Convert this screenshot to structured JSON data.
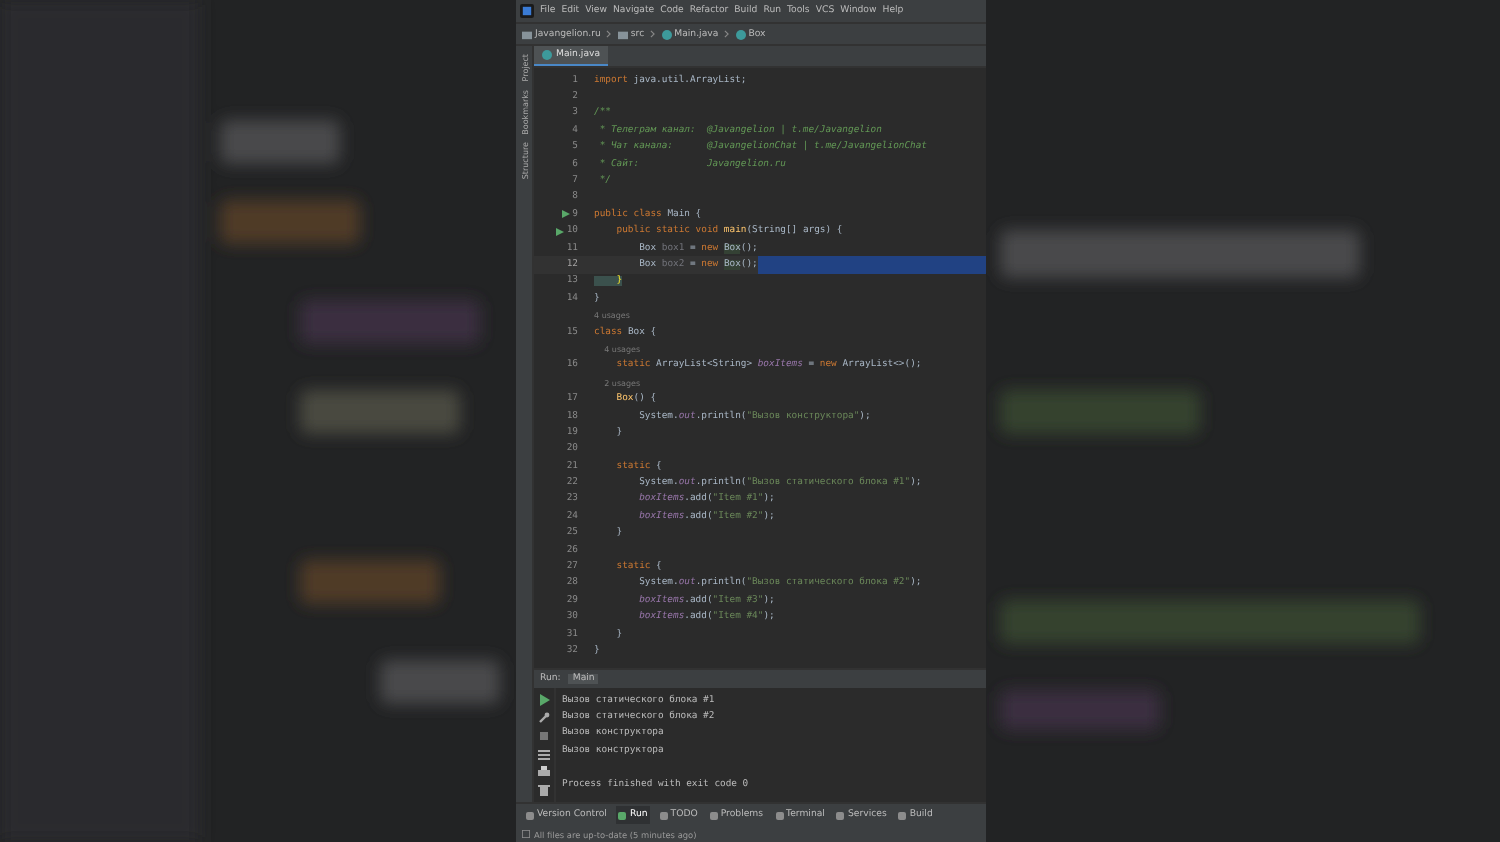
{
  "background": {
    "kind": "picture"
  },
  "menu": [
    "File",
    "Edit",
    "View",
    "Navigate",
    "Code",
    "Refactor",
    "Build",
    "Run",
    "Tools",
    "VCS",
    "Window",
    "Help"
  ],
  "breadcrumbs": [
    {
      "label": "Javangelion.ru",
      "kind": "folder"
    },
    {
      "label": "src",
      "kind": "folder"
    },
    {
      "label": "Main.java",
      "kind": "class"
    },
    {
      "label": "Box",
      "kind": "class"
    }
  ],
  "editor_tabs": [
    {
      "label": "Main.java",
      "selected": true
    }
  ],
  "side_tools": [
    "Project",
    "Bookmarks",
    "Structure"
  ],
  "code": [
    {
      "number": "1",
      "tokens": [
        {
          "kind": "kw",
          "text": "import"
        },
        {
          "kind": "plain",
          "text": " java.util.ArrayList;"
        }
      ]
    },
    {
      "number": "2"
    },
    {
      "number": "3",
      "tokens": [
        {
          "kind": "doc",
          "text": "/**"
        }
      ]
    },
    {
      "number": "4",
      "tokens": [
        {
          "kind": "doc",
          "text": " * Телеграм канал:  @Javangelion | t.me/Javangelion"
        }
      ]
    },
    {
      "number": "5",
      "tokens": [
        {
          "kind": "doc",
          "text": " * Чат канала:      @JavangelionChat | t.me/JavangelionChat"
        }
      ]
    },
    {
      "number": "6",
      "tokens": [
        {
          "kind": "doc",
          "text": " * Сайт:            Javangelion.ru"
        }
      ]
    },
    {
      "number": "7",
      "tokens": [
        {
          "kind": "doc",
          "text": " */"
        }
      ]
    },
    {
      "number": "8"
    },
    {
      "number": "9",
      "run": true,
      "tokens": [
        {
          "kind": "kw",
          "text": "public class "
        },
        {
          "kind": "plain",
          "text": "Main {"
        }
      ]
    },
    {
      "number": "10",
      "run": true,
      "tokens": [
        {
          "kind": "kw",
          "text": "    public static void "
        },
        {
          "kind": "fn",
          "text": "main"
        },
        {
          "kind": "plain",
          "text": "(String[] args) {"
        }
      ]
    },
    {
      "number": "11",
      "tokens": [
        {
          "kind": "plain",
          "text": "        Box "
        },
        {
          "kind": "unused",
          "text": "box1"
        },
        {
          "kind": "plain",
          "text": " = "
        },
        {
          "kind": "kw",
          "text": "new "
        },
        {
          "kind": "ref",
          "text": "Box"
        },
        {
          "kind": "plain",
          "text": "();"
        }
      ]
    },
    {
      "number": "12",
      "current": true,
      "tokens": [
        {
          "kind": "plain",
          "text": "        Box "
        },
        {
          "kind": "unused",
          "text": "box2"
        },
        {
          "kind": "plain",
          "text": " = "
        },
        {
          "kind": "kw",
          "text": "new "
        },
        {
          "kind": "ref",
          "text": "Box"
        },
        {
          "kind": "plain",
          "text": "();"
        }
      ]
    },
    {
      "number": "13",
      "tokens": [
        {
          "kind": "brace",
          "text": "    }"
        }
      ]
    },
    {
      "number": "14",
      "tokens": [
        {
          "kind": "plain",
          "text": "}"
        }
      ]
    },
    {
      "kind": "hint",
      "text": "4 usages"
    },
    {
      "number": "15",
      "tokens": [
        {
          "kind": "kw",
          "text": "class "
        },
        {
          "kind": "plain",
          "text": "Box {"
        }
      ]
    },
    {
      "kind": "hint",
      "text": "4 usages"
    },
    {
      "number": "16",
      "tokens": [
        {
          "kind": "kw",
          "text": "    static "
        },
        {
          "kind": "plain",
          "text": "ArrayList<String> "
        },
        {
          "kind": "fld",
          "text": "boxItems"
        },
        {
          "kind": "plain",
          "text": " = "
        },
        {
          "kind": "kw",
          "text": "new "
        },
        {
          "kind": "plain",
          "text": "ArrayList<>();"
        }
      ]
    },
    {
      "kind": "hint",
      "text": "2 usages"
    },
    {
      "number": "17",
      "tokens": [
        {
          "kind": "fn",
          "text": "    Box"
        },
        {
          "kind": "plain",
          "text": "() {"
        }
      ]
    },
    {
      "number": "18",
      "tokens": [
        {
          "kind": "plain",
          "text": "        System."
        },
        {
          "kind": "fld",
          "text": "out"
        },
        {
          "kind": "plain",
          "text": ".println("
        },
        {
          "kind": "str",
          "text": "\"Вызов конструктора\""
        },
        {
          "kind": "plain",
          "text": ");"
        }
      ]
    },
    {
      "number": "19",
      "tokens": [
        {
          "kind": "plain",
          "text": "    }"
        }
      ]
    },
    {
      "number": "20"
    },
    {
      "number": "21",
      "tokens": [
        {
          "kind": "kw",
          "text": "    static"
        },
        {
          "kind": "plain",
          "text": " {"
        }
      ]
    },
    {
      "number": "22",
      "tokens": [
        {
          "kind": "plain",
          "text": "        System."
        },
        {
          "kind": "fld",
          "text": "out"
        },
        {
          "kind": "plain",
          "text": ".println("
        },
        {
          "kind": "str",
          "text": "\"Вызов статического блока #1\""
        },
        {
          "kind": "plain",
          "text": ");"
        }
      ]
    },
    {
      "number": "23",
      "tokens": [
        {
          "kind": "fld",
          "text": "        boxItems"
        },
        {
          "kind": "plain",
          "text": ".add("
        },
        {
          "kind": "str",
          "text": "\"Item #1\""
        },
        {
          "kind": "plain",
          "text": ");"
        }
      ]
    },
    {
      "number": "24",
      "tokens": [
        {
          "kind": "fld",
          "text": "        boxItems"
        },
        {
          "kind": "plain",
          "text": ".add("
        },
        {
          "kind": "str",
          "text": "\"Item #2\""
        },
        {
          "kind": "plain",
          "text": ");"
        }
      ]
    },
    {
      "number": "25",
      "tokens": [
        {
          "kind": "plain",
          "text": "    }"
        }
      ]
    },
    {
      "number": "26"
    },
    {
      "number": "27",
      "tokens": [
        {
          "kind": "kw",
          "text": "    static"
        },
        {
          "kind": "plain",
          "text": " {"
        }
      ]
    },
    {
      "number": "28",
      "tokens": [
        {
          "kind": "plain",
          "text": "        System."
        },
        {
          "kind": "fld",
          "text": "out"
        },
        {
          "kind": "plain",
          "text": ".println("
        },
        {
          "kind": "str",
          "text": "\"Вызов статического блока #2\""
        },
        {
          "kind": "plain",
          "text": ");"
        }
      ]
    },
    {
      "number": "29",
      "tokens": [
        {
          "kind": "fld",
          "text": "        boxItems"
        },
        {
          "kind": "plain",
          "text": ".add("
        },
        {
          "kind": "str",
          "text": "\"Item #3\""
        },
        {
          "kind": "plain",
          "text": ");"
        }
      ]
    },
    {
      "number": "30",
      "tokens": [
        {
          "kind": "fld",
          "text": "        boxItems"
        },
        {
          "kind": "plain",
          "text": ".add("
        },
        {
          "kind": "str",
          "text": "\"Item #4\""
        },
        {
          "kind": "plain",
          "text": ");"
        }
      ]
    },
    {
      "number": "31",
      "tokens": [
        {
          "kind": "plain",
          "text": "    }"
        }
      ]
    },
    {
      "number": "32",
      "tokens": [
        {
          "kind": "plain",
          "text": "}"
        }
      ]
    }
  ],
  "run_panel": {
    "label": "Run:",
    "tabs": [
      {
        "label": "Main",
        "selected": true
      }
    ],
    "output": [
      {
        "kind": "out",
        "text": "Вызов статического блока #1"
      },
      {
        "kind": "out",
        "text": "Вызов статического блока #2"
      },
      {
        "kind": "out",
        "text": "Вызов конструктора"
      },
      {
        "kind": "out",
        "text": "Вызов конструктора"
      },
      {
        "kind": "exit",
        "text": "Process finished with exit code 0"
      }
    ]
  },
  "tool_windows": [
    {
      "label": "Version Control",
      "selected": false
    },
    {
      "label": "Run",
      "selected": true
    },
    {
      "label": "TODO",
      "selected": false
    },
    {
      "label": "Problems",
      "selected": false
    },
    {
      "label": "Terminal",
      "selected": false
    },
    {
      "label": "Services",
      "selected": false
    },
    {
      "label": "Build",
      "selected": false
    }
  ],
  "status_bar": "All files are up-to-date (5 minutes ago)"
}
